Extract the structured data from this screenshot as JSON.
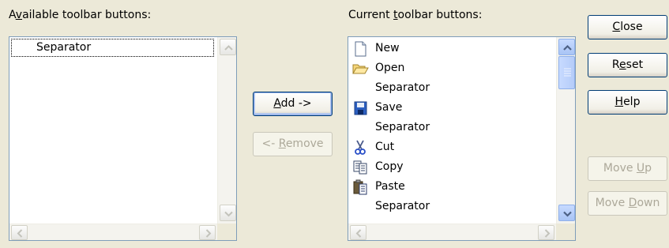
{
  "available": {
    "label_pre": "A",
    "label_accel": "v",
    "label_post": "ailable toolbar buttons:",
    "items": [
      {
        "label": "Separator",
        "icon": "none"
      }
    ]
  },
  "current": {
    "label_pre": "Current ",
    "label_accel": "t",
    "label_post": "oolbar buttons:",
    "items": [
      {
        "label": "New",
        "icon": "new-document-icon"
      },
      {
        "label": "Open",
        "icon": "open-folder-icon"
      },
      {
        "label": "Separator",
        "icon": "none"
      },
      {
        "label": "Save",
        "icon": "save-disk-icon"
      },
      {
        "label": "Separator",
        "icon": "none"
      },
      {
        "label": "Cut",
        "icon": "scissors-icon"
      },
      {
        "label": "Copy",
        "icon": "copy-icon"
      },
      {
        "label": "Paste",
        "icon": "paste-icon"
      },
      {
        "label": "Separator",
        "icon": "none"
      }
    ]
  },
  "buttons": {
    "add": {
      "accel": "A",
      "post": "dd ->"
    },
    "remove": {
      "pre": "<- ",
      "accel": "R",
      "post": "emove"
    },
    "close": {
      "accel": "C",
      "post": "lose"
    },
    "reset": {
      "pre": "R",
      "accel": "e",
      "post": "set"
    },
    "help": {
      "accel": "H",
      "post": "elp"
    },
    "move_up": {
      "pre": "Move ",
      "accel": "U",
      "post": "p"
    },
    "move_down": {
      "pre": "Move ",
      "accel": "D",
      "post": "own"
    }
  },
  "colors": {
    "dialog_bg": "#ece9d8",
    "list_border": "#7f9db9",
    "button_border": "#003c74",
    "scroll_active": "#b5ccf9"
  }
}
